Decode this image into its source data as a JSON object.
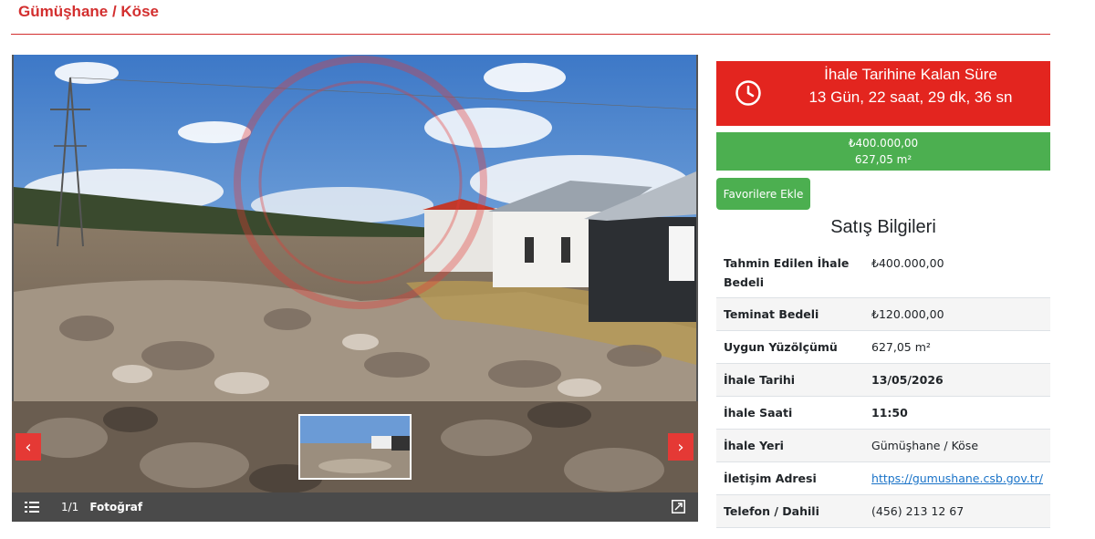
{
  "header": {
    "title": "Gümüşhane / Köse"
  },
  "gallery": {
    "counter": "1/1",
    "label": "Fotoğraf",
    "prev_glyph": "‹",
    "next_glyph": "›",
    "icons": [
      "list-icon",
      "expand-icon",
      "chevron-left-icon",
      "chevron-right-icon"
    ]
  },
  "countdown": {
    "title": "İhale Tarihine Kalan Süre",
    "value": "13 Gün, 22 saat, 29 dk, 36 sn",
    "color": "#e3251f"
  },
  "price": {
    "amount": "₺400.000,00",
    "area": "627,05 m²",
    "color": "#4caf50"
  },
  "favorite_button": {
    "label": "Favorilere Ekle"
  },
  "sale_info": {
    "title": "Satış Bilgileri",
    "rows": [
      {
        "key": "Tahmin Edilen İhale Bedeli",
        "value": "₺400.000,00"
      },
      {
        "key": "Teminat Bedeli",
        "value": "₺120.000,00"
      },
      {
        "key": "Uygun Yüzölçümü",
        "value": "627,05 m²"
      },
      {
        "key": "İhale Tarihi",
        "value": "13/05/2026"
      },
      {
        "key": "İhale Saati",
        "value": "11:50"
      },
      {
        "key": "İhale Yeri",
        "value": "Gümüşhane / Köse"
      },
      {
        "key": "İletişim Adresi",
        "value": "https://gumushane.csb.gov.tr/"
      },
      {
        "key": "Telefon / Dahili",
        "value": "(456) 213 12 67"
      }
    ]
  }
}
